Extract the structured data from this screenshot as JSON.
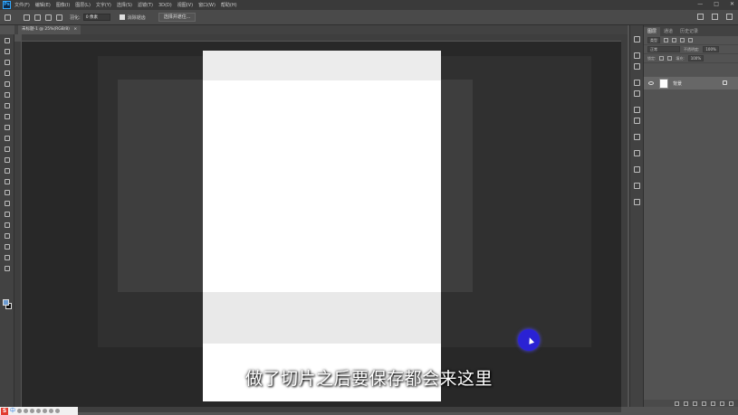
{
  "app": {
    "logo": "Ps"
  },
  "menubar": {
    "items": [
      "文件(F)",
      "编辑(E)",
      "图像(I)",
      "图层(L)",
      "文字(Y)",
      "选择(S)",
      "滤镜(T)",
      "3D(D)",
      "视图(V)",
      "窗口(W)",
      "帮助(H)"
    ]
  },
  "window_controls": [
    "—",
    "□",
    "✕"
  ],
  "options_bar": {
    "feather_label": "羽化:",
    "feather_value": "0 像素",
    "antialias_label": "消除锯齿",
    "select_mask_button": "选择并遮住..."
  },
  "document_tab": {
    "title": "未标题-1 @ 25%(RGB/8)",
    "close": "×"
  },
  "panel": {
    "tabs": [
      "图层",
      "通道",
      "历史记录"
    ],
    "kind_label": "类型",
    "blend_mode": "正常",
    "opacity_label": "不透明度:",
    "opacity_value": "100%",
    "lock_label": "锁定:",
    "fill_label": "填充:",
    "fill_value": "100%",
    "layers": [
      {
        "name": "背景",
        "locked": true,
        "visible": true
      }
    ]
  },
  "subtitle": "做了切片之后要保存都会来这里",
  "taskbar": {
    "logo": "S",
    "text": "中"
  },
  "colors": {
    "foreground": "#6b9bd1",
    "background": "#111111",
    "accent": "#31a8ff",
    "cursor_highlight": "#2a22d4"
  }
}
